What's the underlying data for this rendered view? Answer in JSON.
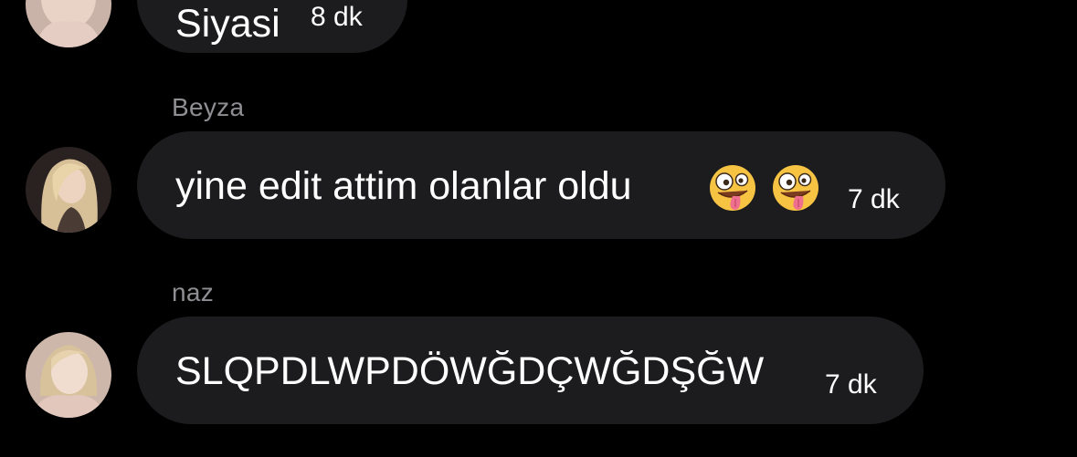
{
  "messages": [
    {
      "sender": "",
      "text": "Siyasi",
      "time": "8 dk"
    },
    {
      "sender": "Beyza",
      "text": "yine edit attim olanlar oldu",
      "emojis": [
        "zany-face-emoji",
        "zany-face-emoji"
      ],
      "time": "7 dk"
    },
    {
      "sender": "naz",
      "text": "SLQPDLWPDÖWĞDÇWĞDŞĞW",
      "time": "7 dk"
    }
  ],
  "colors": {
    "background": "#000000",
    "bubble": "#1c1c1e",
    "sender_name": "#8e8e93",
    "text": "#ffffff"
  }
}
